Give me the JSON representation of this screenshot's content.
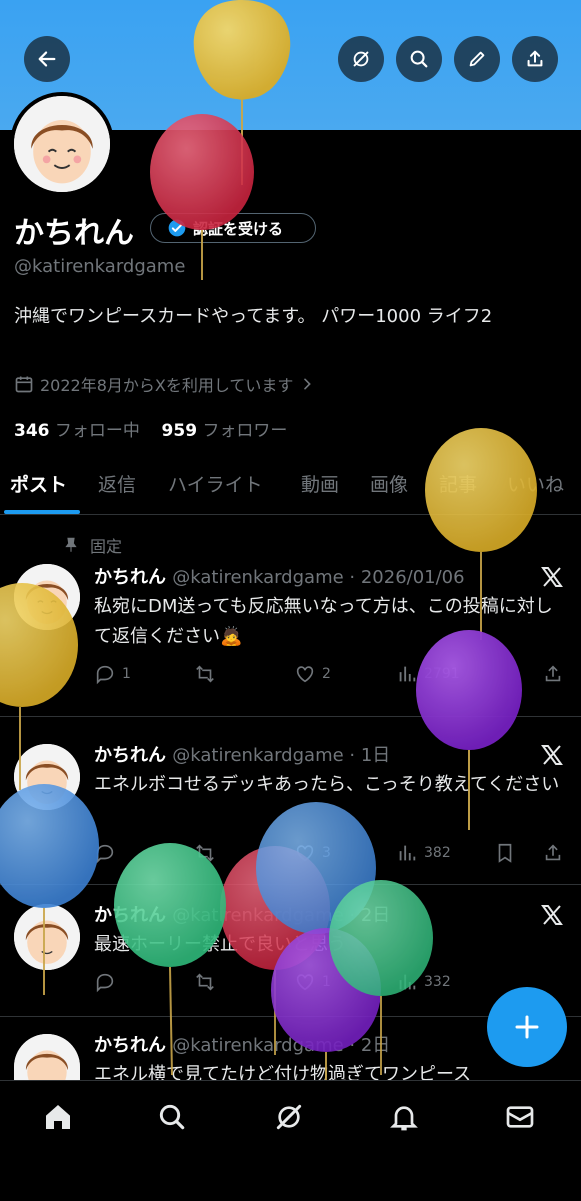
{
  "profile": {
    "name": "かちれん",
    "verify_label": "認証を受ける",
    "handle": "@katirenkardgame",
    "bio": "沖縄でワンピースカードやってます。 パワー1000 ライフ2",
    "joined": "2022年8月からXを利用しています",
    "following_count": "346",
    "following_label": "フォロー中",
    "followers_count": "959",
    "followers_label": "フォロワー"
  },
  "tabs": [
    "ポスト",
    "返信",
    "ハイライト",
    "動画",
    "画像",
    "記事",
    "いいね"
  ],
  "pinned_label": "固定",
  "tweets": [
    {
      "name": "かちれん",
      "meta": "@katirenkardgame · 2026/01/06",
      "text": "私宛にDM送っても反応無いなって方は、この投稿に対して返信ください🙇",
      "replies": "1",
      "likes": "2",
      "views": "2791"
    },
    {
      "name": "かちれん",
      "meta": "@katirenkardgame · 1日",
      "text": "エネルボコせるデッキあったら、こっそり教えてください",
      "replies": "",
      "likes": "3",
      "views": "382"
    },
    {
      "name": "かちれん",
      "meta": "@katirenkardgame · 2日",
      "text": "最速ホーリー禁止で良いと思う",
      "replies": "",
      "likes": "1",
      "views": "332"
    },
    {
      "name": "かちれん",
      "meta": "@katirenkardgame · 2日",
      "text": "エネル横で見てたけど付け物過ぎてワンピース",
      "replies": "",
      "likes": "",
      "views": ""
    }
  ],
  "colors": {
    "accent": "#1d9bf0",
    "banner": "#4aa9f0",
    "balloon_yellow": "#e3bd3b",
    "balloon_red": "#d9314b",
    "balloon_purple": "#8a2fd0",
    "balloon_blue": "#4a90e2",
    "balloon_green": "#3fce8e"
  },
  "icons": {
    "header": [
      "back-arrow-icon",
      "grok-icon",
      "search-icon",
      "pencil-icon",
      "share-icon"
    ],
    "nav": [
      "home-icon",
      "search-icon",
      "grok-icon",
      "bell-icon",
      "mail-icon"
    ]
  }
}
